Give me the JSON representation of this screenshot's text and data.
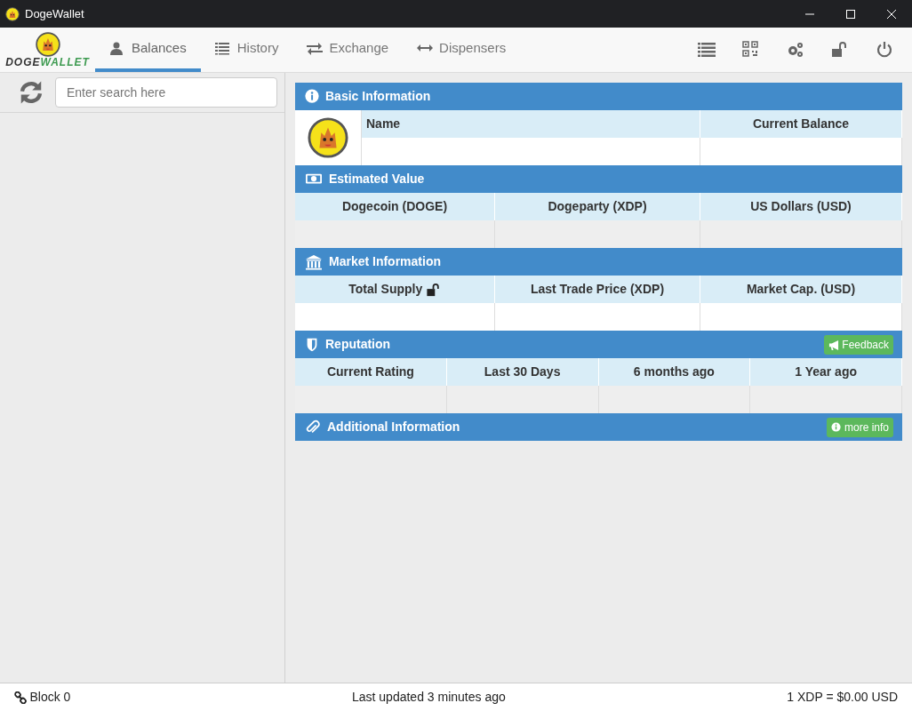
{
  "window": {
    "title": "DogeWallet"
  },
  "logo": {
    "part_1": "DOGE",
    "part_2": "WALLET"
  },
  "tabs": [
    {
      "label": "Balances",
      "selected": true
    },
    {
      "label": "History",
      "selected": false
    },
    {
      "label": "Exchange",
      "selected": false
    },
    {
      "label": "Dispensers",
      "selected": false
    }
  ],
  "search": {
    "placeholder": "Enter search here"
  },
  "sections": [
    {
      "title": "Basic Information",
      "kind": "basic",
      "columns": [
        "Name",
        "Current Balance"
      ]
    },
    {
      "title": "Estimated Value",
      "kind": "grid",
      "columns": [
        "Dogecoin (DOGE)",
        "Dogeparty (XDP)",
        "US Dollars (USD)"
      ]
    },
    {
      "title": "Market Information",
      "kind": "grid",
      "columns": [
        "Total Supply",
        "Last Trade Price (XDP)",
        "Market Cap. (USD)"
      ]
    },
    {
      "title": "Reputation",
      "kind": "grid",
      "columns": [
        "Current Rating",
        "Last 30 Days",
        "6 months ago",
        "1 Year ago"
      ],
      "button": "Feedback"
    },
    {
      "title": "Additional Information",
      "kind": "header",
      "button": "more info"
    }
  ],
  "status_bar": {
    "block": "Block 0",
    "updated": "Last updated 3 minutes ago",
    "rate": "1 XDP = $0.00 USD"
  }
}
